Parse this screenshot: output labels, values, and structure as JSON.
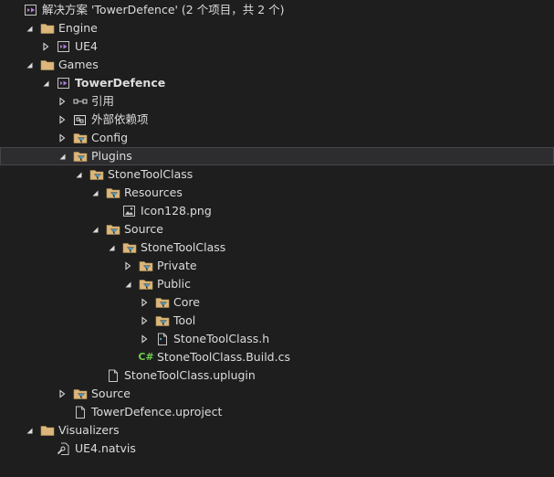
{
  "nodes": [
    {
      "label": "解决方案 'TowerDefence' (2 个项目，共 2 个)",
      "icon": "solution-icon",
      "arrow": "none",
      "depth": 0
    },
    {
      "label": "Engine",
      "icon": "folder-icon",
      "arrow": "expanded",
      "depth": 1
    },
    {
      "label": "UE4",
      "icon": "project-icon",
      "arrow": "collapsed",
      "depth": 2
    },
    {
      "label": "Games",
      "icon": "folder-icon",
      "arrow": "expanded",
      "depth": 1
    },
    {
      "label": "TowerDefence",
      "icon": "project-icon",
      "arrow": "expanded",
      "depth": 2,
      "bold": true
    },
    {
      "label": "引用",
      "icon": "references-icon",
      "arrow": "collapsed",
      "depth": 3
    },
    {
      "label": "外部依赖项",
      "icon": "external-deps-icon",
      "arrow": "collapsed",
      "depth": 3
    },
    {
      "label": "Config",
      "icon": "filter-folder-icon",
      "arrow": "collapsed",
      "depth": 3
    },
    {
      "label": "Plugins",
      "icon": "filter-folder-icon",
      "arrow": "expanded",
      "depth": 3,
      "selected": true
    },
    {
      "label": "StoneToolClass",
      "icon": "filter-folder-icon",
      "arrow": "expanded",
      "depth": 4
    },
    {
      "label": "Resources",
      "icon": "filter-folder-icon",
      "arrow": "expanded",
      "depth": 5
    },
    {
      "label": "Icon128.png",
      "icon": "image-file-icon",
      "arrow": "none",
      "depth": 6
    },
    {
      "label": "Source",
      "icon": "filter-folder-icon",
      "arrow": "expanded",
      "depth": 5
    },
    {
      "label": "StoneToolClass",
      "icon": "filter-folder-icon",
      "arrow": "expanded",
      "depth": 6
    },
    {
      "label": "Private",
      "icon": "filter-folder-icon",
      "arrow": "collapsed",
      "depth": 7
    },
    {
      "label": "Public",
      "icon": "filter-folder-icon",
      "arrow": "expanded",
      "depth": 7
    },
    {
      "label": "Core",
      "icon": "filter-folder-icon",
      "arrow": "collapsed",
      "depth": 8
    },
    {
      "label": "Tool",
      "icon": "filter-folder-icon",
      "arrow": "collapsed",
      "depth": 8
    },
    {
      "label": "StoneToolClass.h",
      "icon": "header-file-icon",
      "arrow": "collapsed",
      "depth": 8
    },
    {
      "label": "StoneToolClass.Build.cs",
      "icon": "csharp-file-icon",
      "arrow": "none",
      "depth": 7,
      "icon_text": "C#"
    },
    {
      "label": "StoneToolClass.uplugin",
      "icon": "file-icon",
      "arrow": "none",
      "depth": 5
    },
    {
      "label": "Source",
      "icon": "filter-folder-icon",
      "arrow": "collapsed",
      "depth": 3
    },
    {
      "label": "TowerDefence.uproject",
      "icon": "file-icon",
      "arrow": "none",
      "depth": 3
    },
    {
      "label": "Visualizers",
      "icon": "folder-icon",
      "arrow": "expanded",
      "depth": 1
    },
    {
      "label": "UE4.natvis",
      "icon": "natvis-file-icon",
      "arrow": "none",
      "depth": 2
    }
  ],
  "colors": {
    "background": "#1e1e1e",
    "text": "#dcdcdc",
    "folder": "#dcb67a",
    "filter_accent": "#519aba",
    "solution": "#b180d7",
    "project": "#b180d7",
    "csharp": "#6fcf4f",
    "selected_row": "#2d2d30"
  }
}
